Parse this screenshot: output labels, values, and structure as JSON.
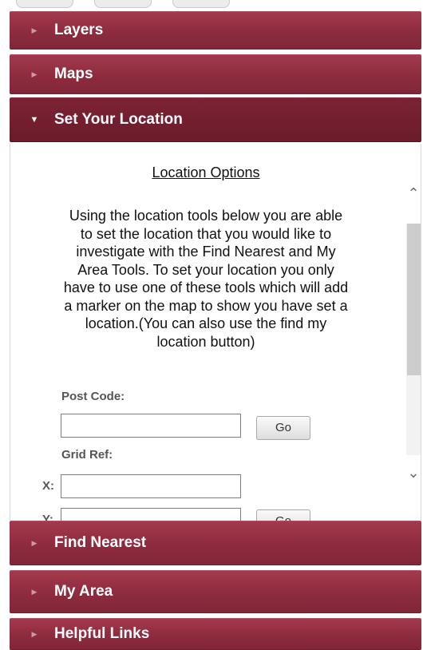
{
  "accordion": {
    "layers": {
      "label": "Layers"
    },
    "maps": {
      "label": "Maps"
    },
    "set_location": {
      "label": "Set Your Location"
    },
    "find_nearest": {
      "label": "Find Nearest"
    },
    "my_area": {
      "label": "My Area"
    },
    "helpful_links": {
      "label": "Helpful Links"
    }
  },
  "location_panel": {
    "title": "Location Options",
    "intro_lines": [
      "Using the location tools below you are able",
      "to set the location that you would like to",
      "investigate with the Find Nearest and My",
      "Area Tools. To set your location you only",
      "have to use one of these tools which will add",
      "a marker on the map to show you have set a",
      "location.(You can also use the find my",
      "location button)"
    ],
    "post_code_label": "Post Code:",
    "post_code_value": "",
    "go_label": "Go",
    "grid_ref_label": "Grid Ref:",
    "x_label": "X:",
    "y_label": "Y:",
    "x_value": "",
    "y_value": ""
  },
  "icons": {
    "collapsed_arrow": "triangle-right",
    "expanded_arrow": "triangle-down",
    "scroll_up": "chevron-up",
    "scroll_down": "chevron-down"
  },
  "colors": {
    "header": "#8e2b3e",
    "header_active": "#6c1b2c",
    "header_text": "#ffffff"
  }
}
